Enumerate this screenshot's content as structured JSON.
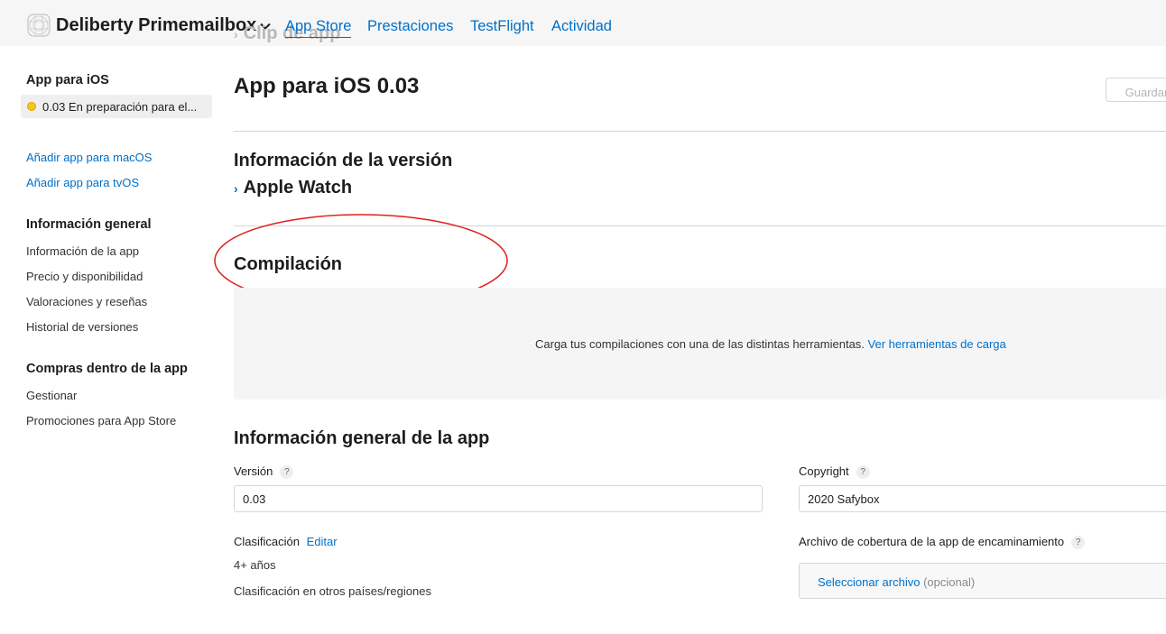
{
  "header": {
    "account_name": "Deliberty Primemailbox",
    "nav": [
      {
        "label": "App Store",
        "active": true
      },
      {
        "label": "Prestaciones",
        "active": false
      },
      {
        "label": "TestFlight",
        "active": false
      },
      {
        "label": "Actividad",
        "active": false
      }
    ],
    "ghost_text": "Clip de app"
  },
  "sidebar": {
    "platform_heading": "App para iOS",
    "selected_version": "0.03 En preparación para el...",
    "version_status_color": "#f5c518",
    "add_links": [
      "Añadir app para macOS",
      "Añadir app para tvOS"
    ],
    "general_heading": "Información general",
    "general_items": [
      "Información de la app",
      "Precio y disponibilidad",
      "Valoraciones y reseñas",
      "Historial de versiones"
    ],
    "purchases_heading": "Compras dentro de la app",
    "purchases_items": [
      "Gestionar",
      "Promociones para App Store"
    ]
  },
  "main": {
    "title": "App para iOS 0.03",
    "save_label": "Guardar",
    "version_info_title": "Información de la versión",
    "apple_watch_label": "Apple Watch",
    "build_title": "Compilación",
    "build_message": "Carga tus compilaciones con una de las distintas herramientas.",
    "build_link": "Ver herramientas de carga",
    "general_title": "Información general de la app",
    "version_label": "Versión",
    "version_value": "0.03",
    "copyright_label": "Copyright",
    "copyright_value": "2020 Safybox",
    "rating_label": "Clasificación",
    "rating_edit": "Editar",
    "rating_value": "4+ años",
    "rating_other_link": "Clasificación en otros países/regiones",
    "routing_label": "Archivo de cobertura de la app de encaminamiento",
    "routing_select": "Seleccionar archivo",
    "routing_optional": "(opcional)",
    "help_glyph": "?"
  },
  "colors": {
    "accent": "#0070c9",
    "annotation": "#e0201b"
  }
}
